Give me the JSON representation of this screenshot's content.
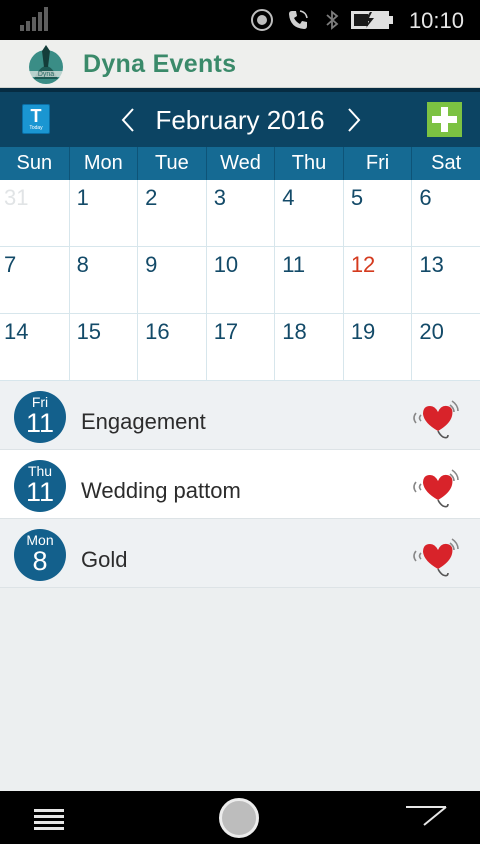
{
  "status_bar": {
    "time": "10:10"
  },
  "app": {
    "title": "Dyna Events"
  },
  "toolbar": {
    "today_label": "T",
    "today_sub": "Today",
    "month": "February 2016"
  },
  "weekdays": [
    "Sun",
    "Mon",
    "Tue",
    "Wed",
    "Thu",
    "Fri",
    "Sat"
  ],
  "weeks": [
    [
      "31",
      "1",
      "2",
      "3",
      "4",
      "5",
      "6"
    ],
    [
      "7",
      "8",
      "9",
      "10",
      "11",
      "12",
      "13"
    ],
    [
      "14",
      "15",
      "16",
      "17",
      "18",
      "19",
      "20"
    ]
  ],
  "events": [
    {
      "dow": "Fri",
      "day": "11",
      "title": "Engagement"
    },
    {
      "dow": "Thu",
      "day": "11",
      "title": "Wedding pattom"
    },
    {
      "dow": "Mon",
      "day": "8",
      "title": "Gold"
    }
  ],
  "colors": {
    "accent": "#0c4463",
    "weekday_bar": "#156a93",
    "today": "#d43a1e",
    "add": "#7cc242",
    "title_green": "#3a8a6a"
  },
  "icons": [
    "signal-icon",
    "record-icon",
    "call-icon",
    "bluetooth-icon",
    "battery-icon",
    "heart-ringing-icon",
    "menu-icon",
    "home-icon",
    "back-icon"
  ]
}
